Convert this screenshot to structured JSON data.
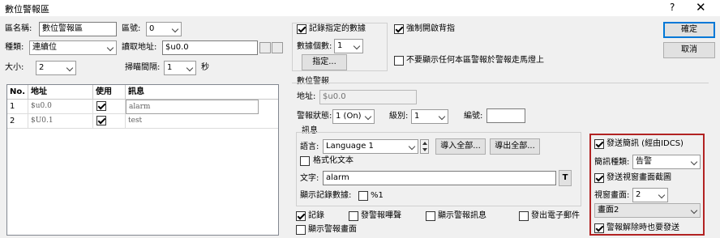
{
  "window": {
    "title": "數位警報區",
    "help": "?",
    "close": "✕"
  },
  "left": {
    "area_name_label": "區名稱:",
    "area_name_value": "數位警報區",
    "area_no_label": "區號:",
    "area_no_value": "0",
    "type_label": "種類:",
    "type_value": "連續位",
    "read_addr_label": "讀取地址:",
    "read_addr_value": "$u0.0",
    "size_label": "大小:",
    "size_value": "2",
    "scan_label": "掃瞄間隔:",
    "scan_value": "1",
    "scan_unit": "秒",
    "table": {
      "headers": [
        "No.",
        "地址",
        "使用",
        "訊息"
      ],
      "rows": [
        {
          "no": "1",
          "addr": "$u0.0",
          "use": true,
          "msg": "alarm"
        },
        {
          "no": "2",
          "addr": "$U0.1",
          "use": true,
          "msg": "test"
        }
      ]
    }
  },
  "middle": {
    "record_label": "記錄指定的數據",
    "record_checked": true,
    "data_count_label": "數據個數:",
    "data_count_value": "1",
    "specify_button": "指定...",
    "force_ack_label": "強制開啟背指",
    "force_ack_checked": true,
    "no_marquee_label": "不要顯示任何本區警報於警報走馬燈上",
    "no_marquee_checked": false,
    "digital_alarm_title": "數位警報",
    "addr_label": "地址:",
    "addr_value": "$u0.0",
    "state_label": "警報狀態:",
    "state_value": "1 (On)",
    "level_label": "級別:",
    "level_value": "1",
    "code_label": "編號:",
    "code_value": "",
    "message_title": "訊息",
    "lang_label": "語言:",
    "lang_value": "Language 1",
    "import_button": "導入全部...",
    "export_button": "導出全部...",
    "formatted_label": "格式化文本",
    "formatted_checked": false,
    "text_label": "文字:",
    "text_value": "alarm",
    "text_button": "T",
    "show_record_label": "顯示記錄數據:",
    "show_record_value": "%1",
    "show_record_checked": false,
    "bottom_checks": [
      {
        "label": "記錄",
        "checked": true
      },
      {
        "label": "發警報嗶聲",
        "checked": false
      },
      {
        "label": "顯示警報訊息",
        "checked": false
      },
      {
        "label": "發出電子郵件",
        "checked": false
      },
      {
        "label": "顯示警報畫面",
        "checked": false
      }
    ]
  },
  "right": {
    "ok_button": "確定",
    "cancel_button": "取消",
    "send_sms_label": "發送簡訊 (經由IDCS)",
    "send_sms_checked": true,
    "sms_type_label": "簡訊種類:",
    "sms_type_value": "告警",
    "send_screenshot_label": "發送視窗畫面截圖",
    "send_screenshot_checked": true,
    "window_screen_label": "視窗畫面:",
    "window_screen_value": "2",
    "screen_name_value": "畫面2",
    "send_on_clear_label": "警報解除時也要發送",
    "send_on_clear_checked": true
  }
}
